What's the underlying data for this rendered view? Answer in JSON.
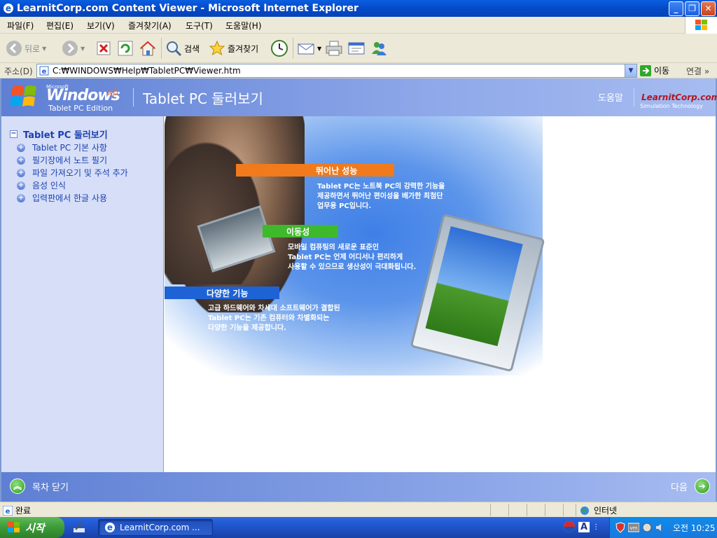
{
  "window": {
    "title": "LearnitCorp.com Content Viewer - Microsoft Internet Explorer",
    "minimize": "_",
    "restore": "❐",
    "close": "✕"
  },
  "menu": [
    "파일(F)",
    "편집(E)",
    "보기(V)",
    "즐겨찾기(A)",
    "도구(T)",
    "도움말(H)"
  ],
  "toolbar": {
    "back": "뒤로",
    "search": "검색",
    "favorites": "즐겨찾기"
  },
  "address": {
    "label": "주소(D)",
    "value": "C:₩WINDOWS₩Help₩TabletPC₩Viewer.htm",
    "go": "이동",
    "links": "연결",
    "more": "»"
  },
  "header": {
    "ms": "Microsoft",
    "windows": "Windows",
    "xp": "xp",
    "edition": "Tablet PC Edition",
    "title": "Tablet PC 둘러보기",
    "help": "도움말",
    "brand": "LearnitCorp.com",
    "brand_tag": "Simulation Technology"
  },
  "sidebar": {
    "root": "Tablet PC 둘러보기",
    "items": [
      {
        "label": "Tablet PC 기본 사항"
      },
      {
        "label": "필기장에서 노트 필기"
      },
      {
        "label": "파일 가져오기 및 주석 추가"
      },
      {
        "label": "음성 인식"
      },
      {
        "label": "입력판에서 한글 사용"
      }
    ]
  },
  "features": [
    {
      "title": "뛰어난 성능",
      "color": "#f07a1c",
      "lines": [
        "Tablet PC는 노트북 PC의 강력한 기능을",
        "제공하면서 뛰어난 편이성을 배가한 최첨단",
        "업무용 PC입니다."
      ]
    },
    {
      "title": "이동성",
      "color": "#3fb92c",
      "lines": [
        "모바일 컴퓨팅의 새로운 표준인",
        "Tablet PC는 언제 어디서나 편리하게",
        "사용할 수 있으므로 생산성이 극대화됩니다."
      ]
    },
    {
      "title": "다양한 기능",
      "color": "#1e63d6",
      "lines": [
        "고급 하드웨어와 차세대 소프트웨어가 결합된",
        "Tablet PC는 기존 컴퓨터와 차별화되는",
        "다양한 기능을 제공합니다."
      ]
    }
  ],
  "footer": {
    "close_toc": "목차 닫기",
    "next": "다음"
  },
  "status": {
    "left": "완료",
    "zone": "인터넷"
  },
  "taskbar": {
    "start": "시작",
    "task": "LearnitCorp.com ...",
    "ime": "A",
    "clock": "오전 10:25"
  },
  "colors": {
    "accent": "#1c3fb1",
    "header": "#6f8fdc",
    "sidebar": "#d6dff7"
  }
}
